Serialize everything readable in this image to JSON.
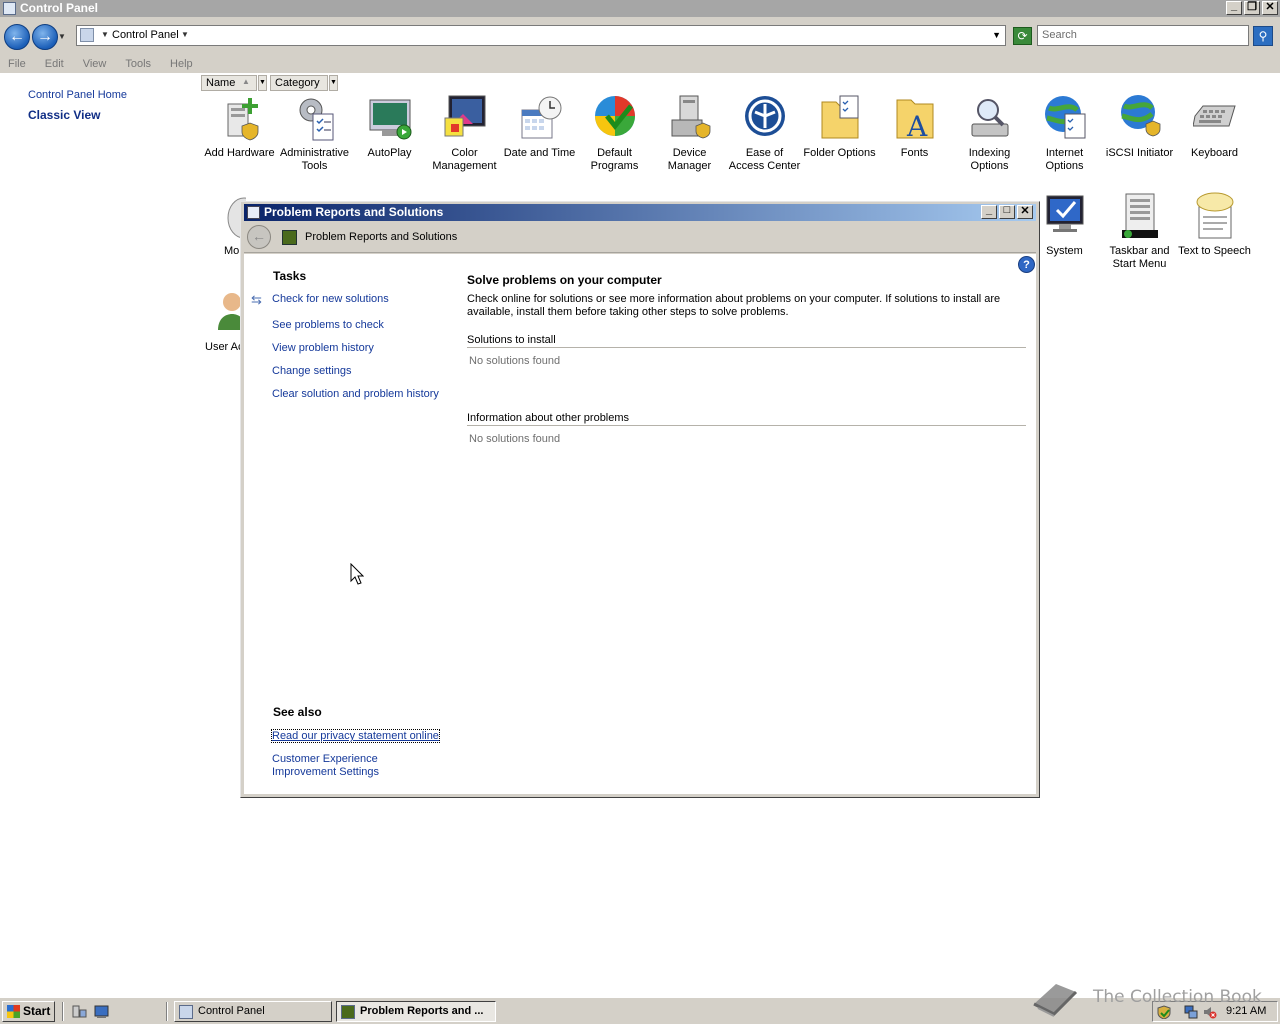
{
  "window": {
    "title": "Control Panel",
    "buttons": [
      "minimize",
      "restore",
      "close"
    ]
  },
  "address_bar": {
    "path": "Control Panel",
    "search_placeholder": "Search"
  },
  "menu": [
    "File",
    "Edit",
    "View",
    "Tools",
    "Help"
  ],
  "left_pane": {
    "home_link": "Control Panel Home",
    "classic_view_link": "Classic View"
  },
  "columns": {
    "name": "Name",
    "category": "Category"
  },
  "cp_items": [
    {
      "label": "Add Hardware",
      "icon": "add-hardware-icon"
    },
    {
      "label": "Administrative Tools",
      "icon": "administrative-tools-icon"
    },
    {
      "label": "AutoPlay",
      "icon": "autoplay-icon"
    },
    {
      "label": "Color Management",
      "icon": "color-management-icon"
    },
    {
      "label": "Date and Time",
      "icon": "date-and-time-icon"
    },
    {
      "label": "Default Programs",
      "icon": "default-programs-icon"
    },
    {
      "label": "Device Manager",
      "icon": "device-manager-icon"
    },
    {
      "label": "Ease of Access Center",
      "icon": "ease-of-access-icon"
    },
    {
      "label": "Folder Options",
      "icon": "folder-options-icon"
    },
    {
      "label": "Fonts",
      "icon": "fonts-icon"
    },
    {
      "label": "Indexing Options",
      "icon": "indexing-options-icon"
    },
    {
      "label": "Internet Options",
      "icon": "internet-options-icon"
    },
    {
      "label": "iSCSI Initiator",
      "icon": "iscsi-initiator-icon"
    },
    {
      "label": "Keyboard",
      "icon": "keyboard-icon"
    }
  ],
  "cp_items_row2_visible": [
    {
      "label": "Mo",
      "icon": "mouse-icon"
    },
    {
      "label": "System",
      "icon": "system-icon"
    },
    {
      "label": "Taskbar and Start Menu",
      "icon": "taskbar-start-menu-icon"
    },
    {
      "label": "Text to Speech",
      "icon": "text-to-speech-icon"
    }
  ],
  "cp_items_row3_visible": [
    {
      "label": "User Ac",
      "icon": "user-accounts-icon"
    }
  ],
  "dialog": {
    "title": "Problem Reports and Solutions",
    "breadcrumb": "Problem Reports and Solutions",
    "tasks_heading": "Tasks",
    "tasks": [
      "Check for new solutions",
      "See problems to check",
      "View problem history",
      "Change settings",
      "Clear solution and problem history"
    ],
    "see_also_heading": "See also",
    "see_also": [
      "Read our privacy statement online",
      "Customer Experience Improvement Settings"
    ],
    "main_heading": "Solve problems on your computer",
    "main_description": "Check online for solutions or see more information about problems on your computer. If solutions to install are available, install them before taking other steps to solve problems.",
    "sections": [
      {
        "heading": "Solutions to install",
        "empty_text": "No solutions found"
      },
      {
        "heading": "Information about other problems",
        "empty_text": "No solutions found"
      }
    ],
    "help_glyph": "?"
  },
  "taskbar": {
    "start_label": "Start",
    "tasks": [
      {
        "label": "Control Panel",
        "active": false
      },
      {
        "label": "Problem Reports and ...",
        "active": true
      }
    ],
    "clock": "9:21 AM"
  },
  "watermark": {
    "text": "The Collection Book"
  }
}
